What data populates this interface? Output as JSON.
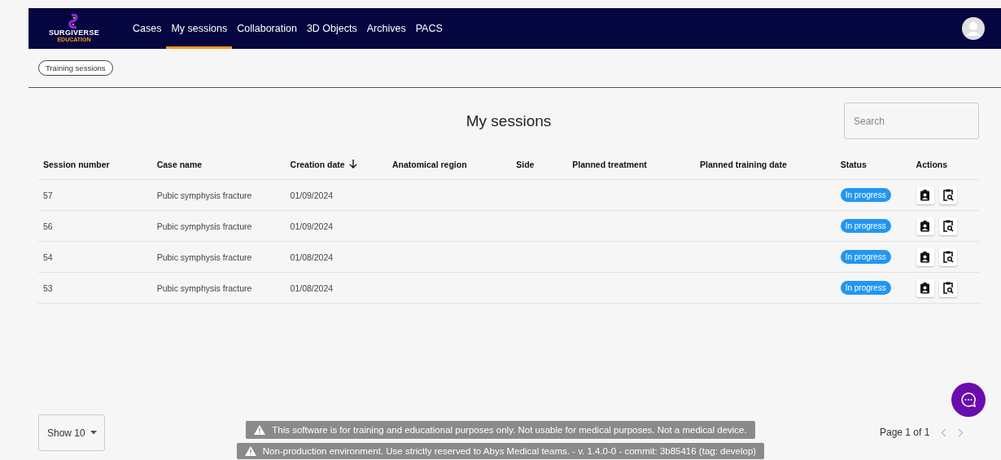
{
  "header": {
    "logo": {
      "name": "SURGIVERSE",
      "sub": "EDUCATION"
    },
    "nav": [
      {
        "label": "Cases",
        "selected": false
      },
      {
        "label": "My sessions",
        "selected": true
      },
      {
        "label": "Collaboration",
        "selected": false
      },
      {
        "label": "3D Objects",
        "selected": false
      },
      {
        "label": "Archives",
        "selected": false
      },
      {
        "label": "PACS",
        "selected": false
      }
    ]
  },
  "filter_chip": "Training sessions",
  "title": "My sessions",
  "search": {
    "placeholder": "Search"
  },
  "table": {
    "columns": [
      {
        "label": "Session number",
        "sorted": false
      },
      {
        "label": "Case name",
        "sorted": false
      },
      {
        "label": "Creation date",
        "sorted": true
      },
      {
        "label": "Anatomical region",
        "sorted": false
      },
      {
        "label": "Side",
        "sorted": false
      },
      {
        "label": "Planned treatment",
        "sorted": false
      },
      {
        "label": "Planned training date",
        "sorted": false
      },
      {
        "label": "Status",
        "sorted": false
      },
      {
        "label": "Actions",
        "sorted": false
      }
    ],
    "rows": [
      {
        "session_number": "57",
        "case_name": "Pubic symphysis fracture",
        "creation_date": "01/09/2024",
        "status": "In progress"
      },
      {
        "session_number": "56",
        "case_name": "Pubic symphysis fracture",
        "creation_date": "01/09/2024",
        "status": "In progress"
      },
      {
        "session_number": "54",
        "case_name": "Pubic symphysis fracture",
        "creation_date": "01/08/2024",
        "status": "In progress"
      },
      {
        "session_number": "53",
        "case_name": "Pubic symphysis fracture",
        "creation_date": "01/08/2024",
        "status": "In progress"
      }
    ]
  },
  "page_size": "Show 10",
  "pagination": "Page 1 of 1",
  "notices": [
    "This software is for training and educational purposes only. Not usable for medical purposes. Not a medical device.",
    "Non-production environment. Use strictly reserved to Abys Medical teams. - v. 1.4.0-0 - commit: 3b85416 (tag: develop)"
  ]
}
